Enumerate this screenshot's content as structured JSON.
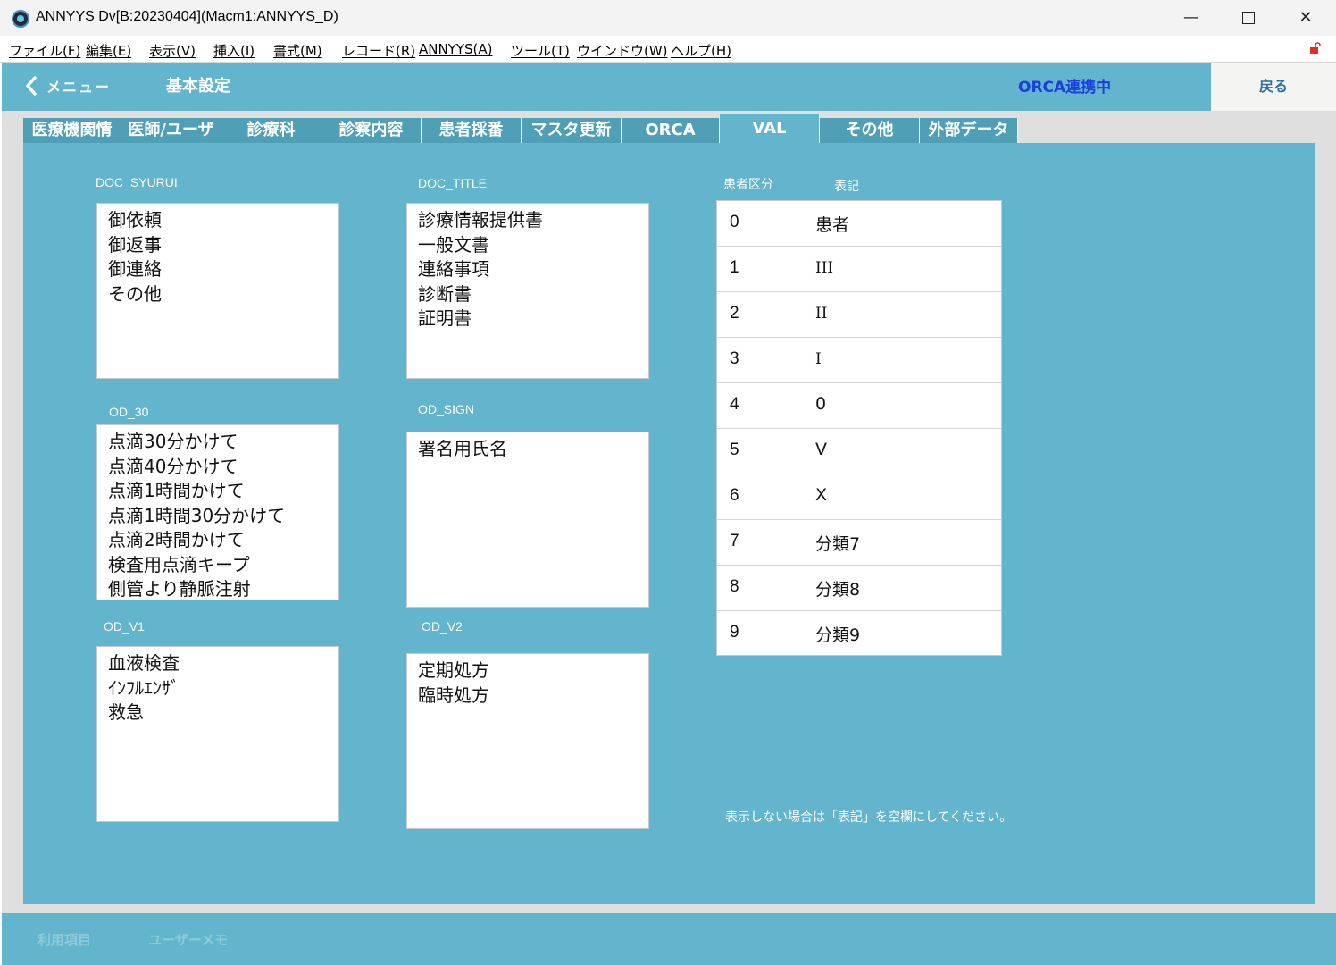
{
  "window": {
    "title": "ANNYYS Dv[B:20230404](Macm1:ANNYYS_D)",
    "minimize": "—",
    "close": "✕"
  },
  "menubar": {
    "items": [
      "ファイル(F)",
      "編集(E)",
      "表示(V)",
      "挿入(I)",
      "書式(M)",
      "レコード(R)",
      "ANNYYS(A)",
      "ツール(T)",
      "ウインドウ(W)",
      "ヘルプ(H)"
    ],
    "lock_icon": "unlock-icon"
  },
  "header": {
    "menu_label": "メニュー",
    "title": "基本設定",
    "status": "ORCA連携中",
    "back_button": "戻る",
    "colors": {
      "header_bg": "#62b5cc",
      "status": "#1a3fe0"
    }
  },
  "tabs": [
    {
      "label": "医療機関情"
    },
    {
      "label": "医師/ユーザ"
    },
    {
      "label": "診療科"
    },
    {
      "label": "診察内容"
    },
    {
      "label": "患者採番"
    },
    {
      "label": "マスタ更新"
    },
    {
      "label": "ORCA"
    },
    {
      "label": "VAL",
      "active": true
    },
    {
      "label": "その他"
    },
    {
      "label": "外部データ"
    }
  ],
  "fields": {
    "doc_syurui": {
      "label": "DOC_SYURUI",
      "items": [
        "御依頼",
        "御返事",
        "御連絡",
        "その他"
      ]
    },
    "doc_title": {
      "label": "DOC_TITLE",
      "items": [
        "診療情報提供書",
        "一般文書",
        "連絡事項",
        "診断書",
        "証明書"
      ]
    },
    "od_30": {
      "label": "OD_30",
      "items": [
        "点滴30分かけて",
        "点滴40分かけて",
        "点滴1時間かけて",
        "点滴1時間30分かけて",
        "点滴2時間かけて",
        "検査用点滴キープ",
        "側管より静脈注射"
      ]
    },
    "od_sign": {
      "label": "OD_SIGN",
      "items": [
        "署名用氏名"
      ]
    },
    "od_v1": {
      "label": "OD_V1",
      "items": [
        "血液検査",
        "ｲﾝﾌﾙｴﾝｻﾞ",
        "救急"
      ]
    },
    "od_v2": {
      "label": "OD_V2",
      "items": [
        "定期処方",
        "臨時処方"
      ]
    }
  },
  "patient_class": {
    "header_code": "患者区分",
    "header_label": "表記",
    "rows": [
      {
        "code": "0",
        "label": "患者"
      },
      {
        "code": "1",
        "label": "III"
      },
      {
        "code": "2",
        "label": "II"
      },
      {
        "code": "3",
        "label": "I"
      },
      {
        "code": "4",
        "label": "0"
      },
      {
        "code": "5",
        "label": "V"
      },
      {
        "code": "6",
        "label": "X"
      },
      {
        "code": "7",
        "label": "分類7"
      },
      {
        "code": "8",
        "label": "分類8"
      },
      {
        "code": "9",
        "label": "分類9"
      }
    ],
    "note": "表示しない場合は「表記」を空欄にしてください。"
  },
  "footer": {
    "items": [
      "利用項目",
      "ユーザーメモ"
    ]
  }
}
